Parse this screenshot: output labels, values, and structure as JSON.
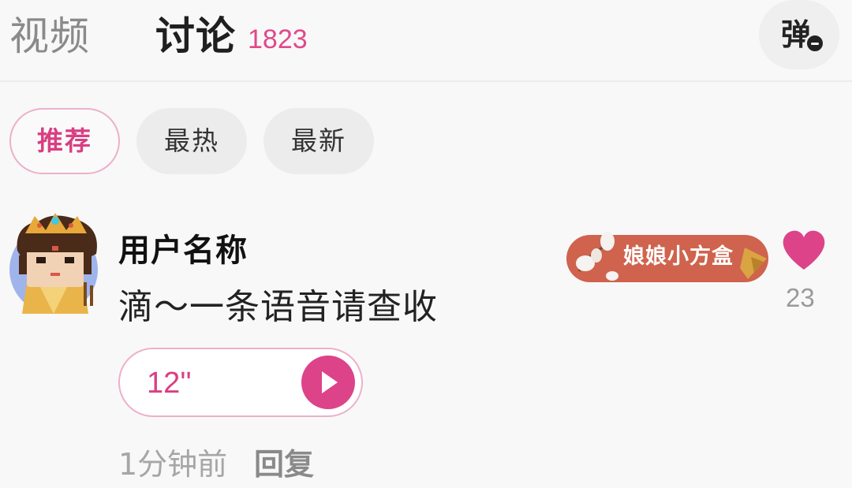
{
  "tabs": {
    "video": "视频",
    "discussion": "讨论",
    "discussion_count": "1823"
  },
  "danmaku": {
    "label": "弹",
    "icon": "danmaku-off-icon"
  },
  "filters": [
    {
      "label": "推荐",
      "selected": true
    },
    {
      "label": "最热",
      "selected": false
    },
    {
      "label": "最新",
      "selected": false
    }
  ],
  "comment": {
    "avatar": "empress-avatar-icon",
    "username": "用户名称",
    "text": "滴～一条语音请查收",
    "voice_duration": "12''",
    "badge": "娘娘小方盒",
    "likes": "23",
    "time": "1分钟前",
    "reply": "回复"
  },
  "colors": {
    "accent_pink": "#dd4389",
    "badge_red": "#cf634e",
    "muted_text": "#a6a6a6"
  }
}
